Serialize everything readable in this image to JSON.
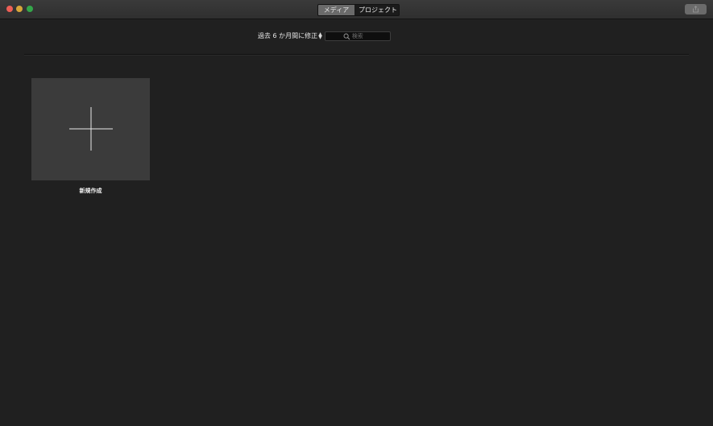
{
  "titlebar": {
    "tabs": [
      {
        "label": "メディア",
        "active": true
      },
      {
        "label": "プロジェクト",
        "active": false
      }
    ],
    "share_icon": "share-icon"
  },
  "toolbar": {
    "filter_label": "過去 6 か月間に修正",
    "search_placeholder": "検索"
  },
  "main": {
    "new_project_label": "新規作成",
    "new_project_icon": "plus-icon"
  },
  "colors": {
    "background": "#202020",
    "tile": "#3b3b3b",
    "active_tab": "#6a6a6a",
    "close": "#ed5f56",
    "minimize": "#d7a63a",
    "maximize": "#34a64a"
  }
}
